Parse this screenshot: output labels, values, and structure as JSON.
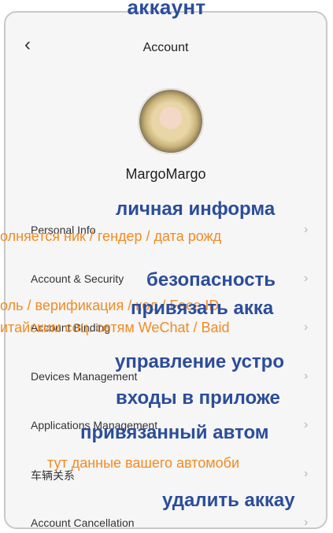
{
  "header": {
    "annotation": "аккаунт",
    "back_icon": "chevron-left-icon",
    "title": "Account"
  },
  "profile": {
    "username": "MargoMargo"
  },
  "menu": {
    "items": [
      {
        "label": "Personal Info",
        "annotation": "личная информа",
        "note": "олняется ник / гендер / дата рожд"
      },
      {
        "label": "Account & Security",
        "annotation": "безопасность",
        "note": "оль / верификация / код / Face ID"
      },
      {
        "label": "Account Binding",
        "annotation": "привязать акка",
        "note": "итайским соц. сетям WeChat / Baid"
      },
      {
        "label": "Devices Management",
        "annotation": "управление устро",
        "note": ""
      },
      {
        "label": "Applications Management",
        "annotation": "входы в приложе",
        "note": ""
      },
      {
        "label": "车辆关系",
        "annotation": "привязанный автом",
        "note": "тут данные вашего автомоби"
      },
      {
        "label": "Account Cancellation",
        "annotation": "удалить аккау",
        "note": ""
      }
    ]
  },
  "colors": {
    "annotation_blue": "#2b4d9a",
    "annotation_orange": "#f28b22"
  }
}
